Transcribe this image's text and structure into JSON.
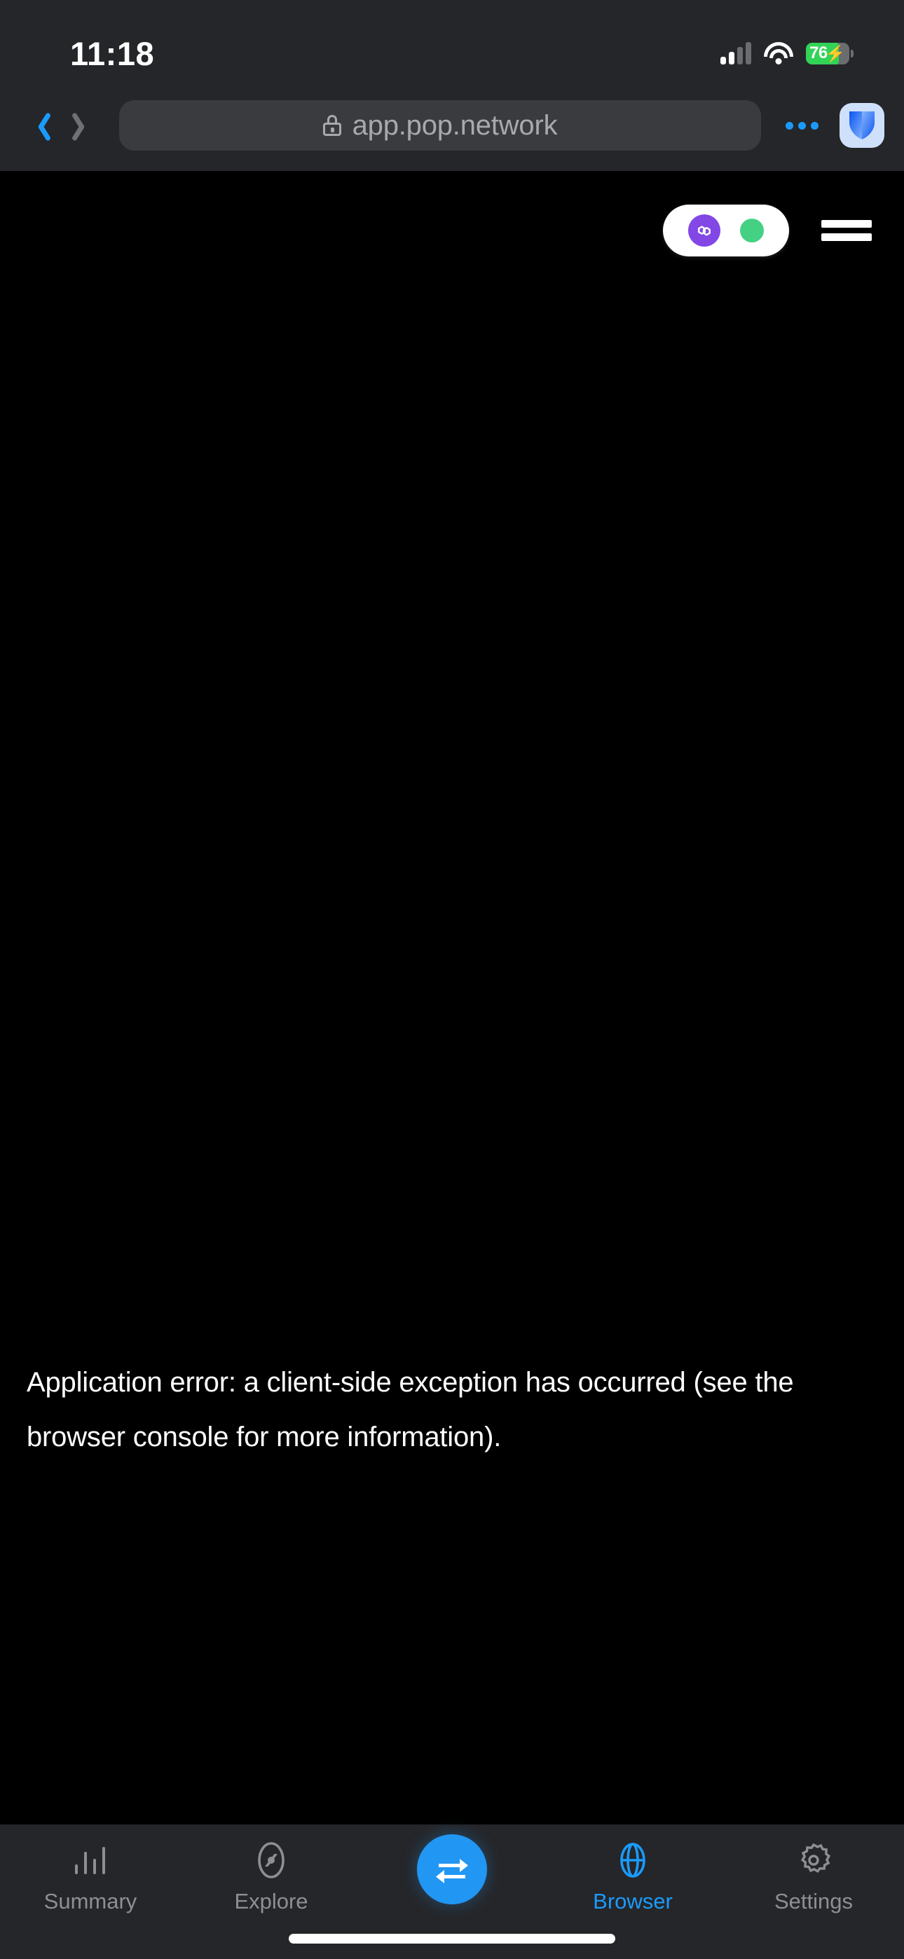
{
  "status_bar": {
    "time": "11:18",
    "battery_percent": "76",
    "battery_level": 76,
    "charging": true,
    "signal_bars": 2,
    "wifi": true,
    "colors": {
      "battery_fill": "#32d357",
      "text": "#ffffff"
    }
  },
  "browser_chrome": {
    "back_label": "Back",
    "forward_label": "Forward",
    "back_enabled": true,
    "forward_enabled": false,
    "url": "app.pop.network",
    "secure": true,
    "menu_label": "More",
    "app_icon_label": "Shield app icon",
    "colors": {
      "bar": "#252629",
      "url_pill": "#3a3b3e",
      "accent": "#1a9bfc",
      "url_text": "#a7a9ac"
    }
  },
  "page": {
    "background": "#000000",
    "wallet": {
      "chain_name": "Polygon",
      "chain_color": "#8247e5",
      "status_color": "#44d184",
      "connected": true
    },
    "menu_label": "Menu",
    "error_message": "Application error: a client-side exception has occurred (see the browser console for more information)."
  },
  "tab_bar": {
    "items": [
      {
        "label": "Summary",
        "icon": "bar-chart-icon",
        "active": false
      },
      {
        "label": "Explore",
        "icon": "compass-icon",
        "active": false
      },
      {
        "label": "Browser",
        "icon": "globe-icon",
        "active": true
      },
      {
        "label": "Settings",
        "icon": "gear-icon",
        "active": false
      }
    ],
    "swap_button_label": "Swap",
    "colors": {
      "bar": "#252629",
      "inactive": "#8d8f93",
      "active": "#1a9bfc",
      "fab": "#2196f3"
    }
  }
}
